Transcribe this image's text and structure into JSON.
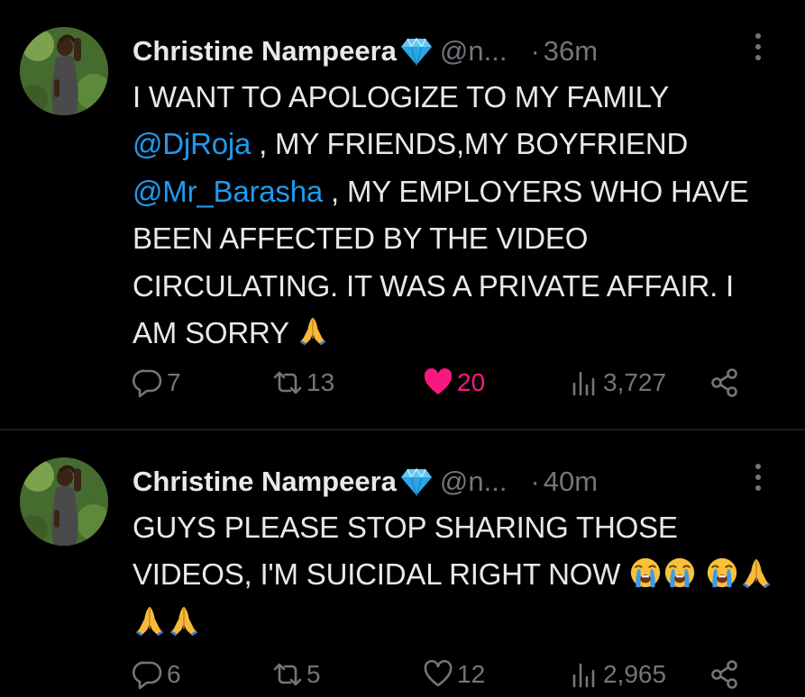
{
  "tweets": [
    {
      "author_name": "Christine Nampeera",
      "handle": "@n...",
      "time": "36m",
      "text_parts": [
        {
          "type": "text",
          "value": "I WANT TO APOLOGIZE TO MY FAMILY "
        },
        {
          "type": "mention",
          "value": "@DjRoja"
        },
        {
          "type": "text",
          "value": " , MY FRIENDS,MY BOYFRIEND "
        },
        {
          "type": "mention",
          "value": "@Mr_Barasha"
        },
        {
          "type": "text",
          "value": " , MY EMPLOYERS WHO HAVE BEEN AFFECTED BY THE VIDEO CIRCULATING. IT WAS A PRIVATE AFFAIR. I AM SORRY"
        }
      ],
      "emojis": [
        "folded-hands"
      ],
      "replies": "7",
      "reposts": "13",
      "likes": "20",
      "liked": true,
      "views": "3,727"
    },
    {
      "author_name": "Christine Nampeera",
      "handle": "@n...",
      "time": "40m",
      "text_parts": [
        {
          "type": "text",
          "value": "GUYS PLEASE STOP SHARING THOSE VIDEOS, I'M SUICIDAL RIGHT NOW"
        }
      ],
      "emojis": [
        "loudly-crying-face",
        "loudly-crying-face",
        "loudly-crying-face",
        "folded-hands",
        "folded-hands",
        "folded-hands"
      ],
      "replies": "6",
      "reposts": "5",
      "likes": "12",
      "liked": false,
      "views": "2,965"
    }
  ],
  "colors": {
    "background": "#000000",
    "text": "#e7e9ea",
    "muted": "#71767b",
    "mention": "#1d9bf0",
    "like_active": "#f91880",
    "verified_badge": "#4fc3f7"
  }
}
